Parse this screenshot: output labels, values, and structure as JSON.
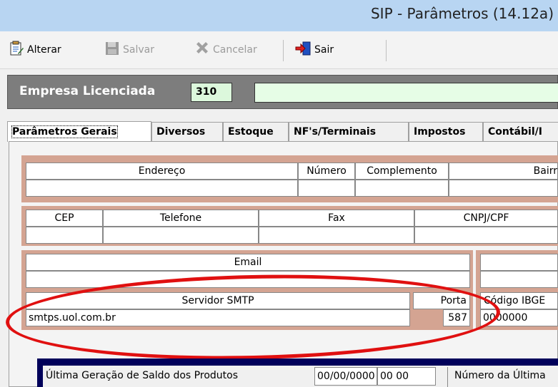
{
  "window": {
    "title": "SIP - Parâmetros  (14.12a)"
  },
  "toolbar": {
    "alterar": "Alterar",
    "salvar": "Salvar",
    "cancelar": "Cancelar",
    "sair": "Sair"
  },
  "empresa": {
    "label": "Empresa Licenciada",
    "code": "310",
    "name": ""
  },
  "tabs": [
    "Parâmetros Gerais",
    "Diversos",
    "Estoque",
    "NF's/Terminais",
    "Impostos",
    "Contábil/I"
  ],
  "row1": {
    "headers": [
      "Endereço",
      "Número",
      "Complemento",
      "Bairr"
    ],
    "values": [
      "",
      "",
      "",
      ""
    ]
  },
  "row2": {
    "headers": [
      "CEP",
      "Telefone",
      "Fax",
      "CNPJ/CPF"
    ],
    "values": [
      "",
      "",
      "",
      ""
    ]
  },
  "email": {
    "header": "Email",
    "value": ""
  },
  "smtp": {
    "header": "Servidor SMTP",
    "value": "smtps.uol.com.br",
    "porta_header": "Porta",
    "porta_value": "587"
  },
  "ibge": {
    "header": "Código IBGE",
    "value": "0000000"
  },
  "bottom": {
    "label": "Última Geração de Saldo dos Produtos",
    "date": "00/00/0000",
    "time": "00 00",
    "label2": "Número da Última"
  },
  "colors": {
    "highlight_ellipse": "#e01010",
    "field_bg": "#dcf8dc",
    "frame_bg": "#d4a492"
  }
}
